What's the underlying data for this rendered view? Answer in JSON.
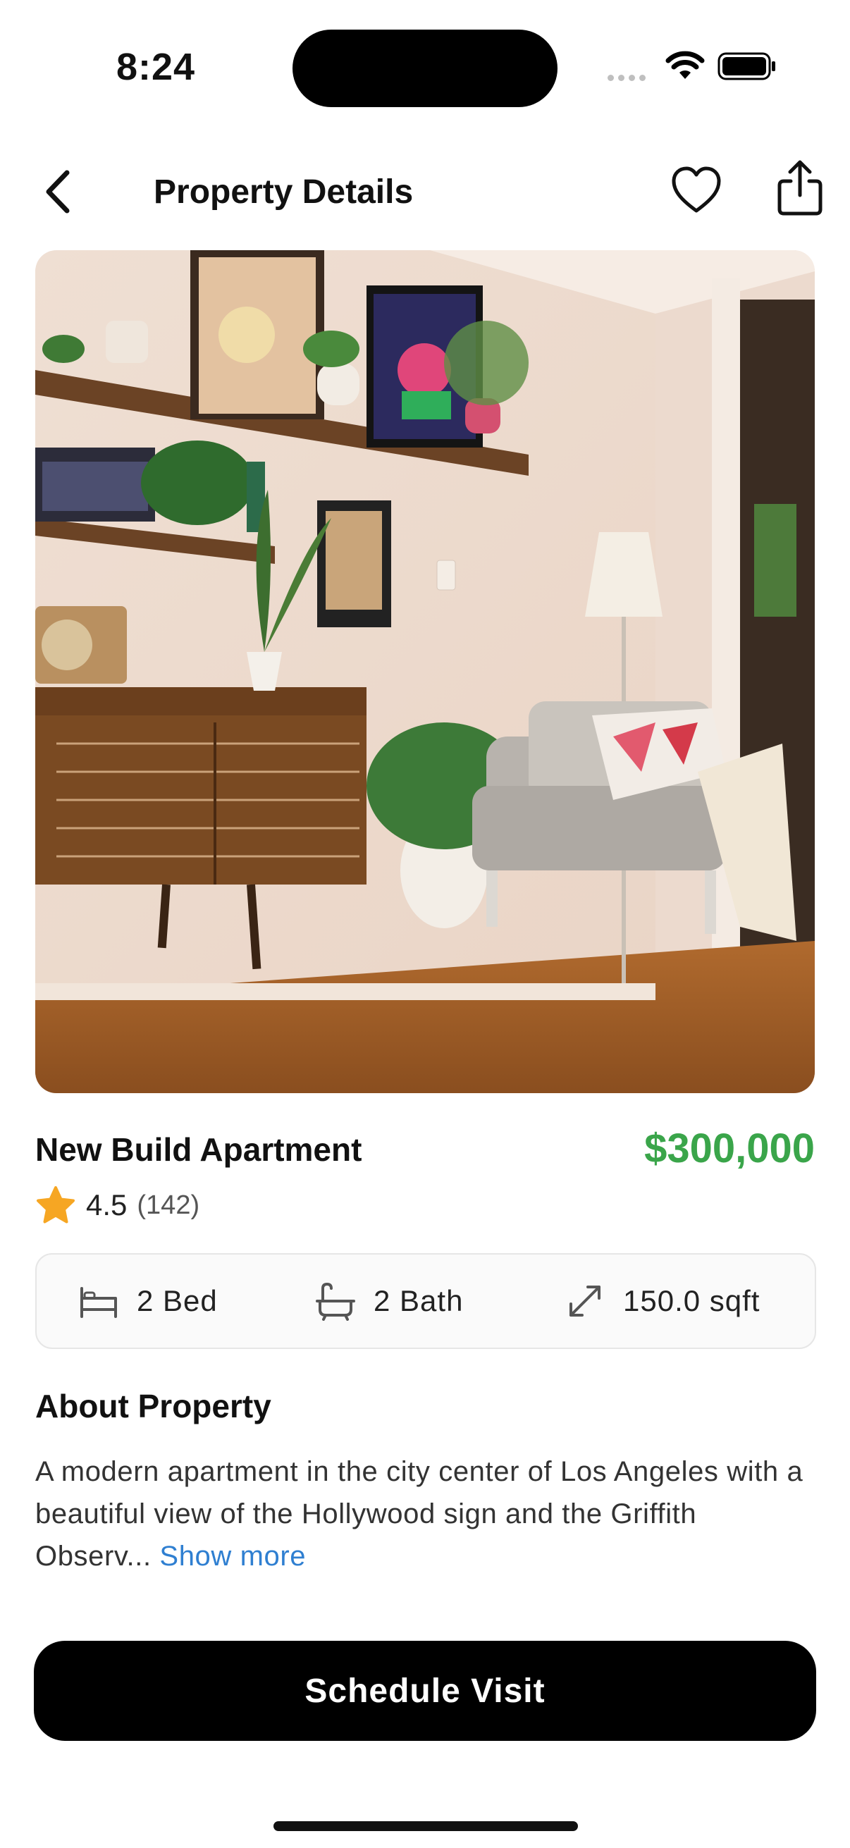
{
  "status_bar": {
    "time": "8:24",
    "icons": [
      "signal-icon",
      "wifi-icon",
      "battery-icon"
    ]
  },
  "header": {
    "title": "Property Details",
    "back_icon": "chevron-left-icon",
    "favorite_icon": "heart-icon",
    "share_icon": "share-icon"
  },
  "listing": {
    "title": "New Build Apartment",
    "price": "$300,000",
    "price_color": "#3aa54a",
    "rating": "4.5",
    "review_count": "(142)",
    "features": [
      {
        "icon": "bed-icon",
        "label": "2 Bed"
      },
      {
        "icon": "bath-icon",
        "label": "2 Bath"
      },
      {
        "icon": "expand-icon",
        "label": "150.0 sqft"
      }
    ]
  },
  "about": {
    "title": "About Property",
    "description": "A modern apartment in the city center of Los Angeles with a beautiful view of the Hollywood sign and the Griffith Observ...",
    "show_more": "Show more"
  },
  "cta": {
    "label": "Schedule Visit"
  },
  "colors": {
    "accent": "#2f7fd1",
    "price": "#3aa54a",
    "button": "#000000"
  }
}
